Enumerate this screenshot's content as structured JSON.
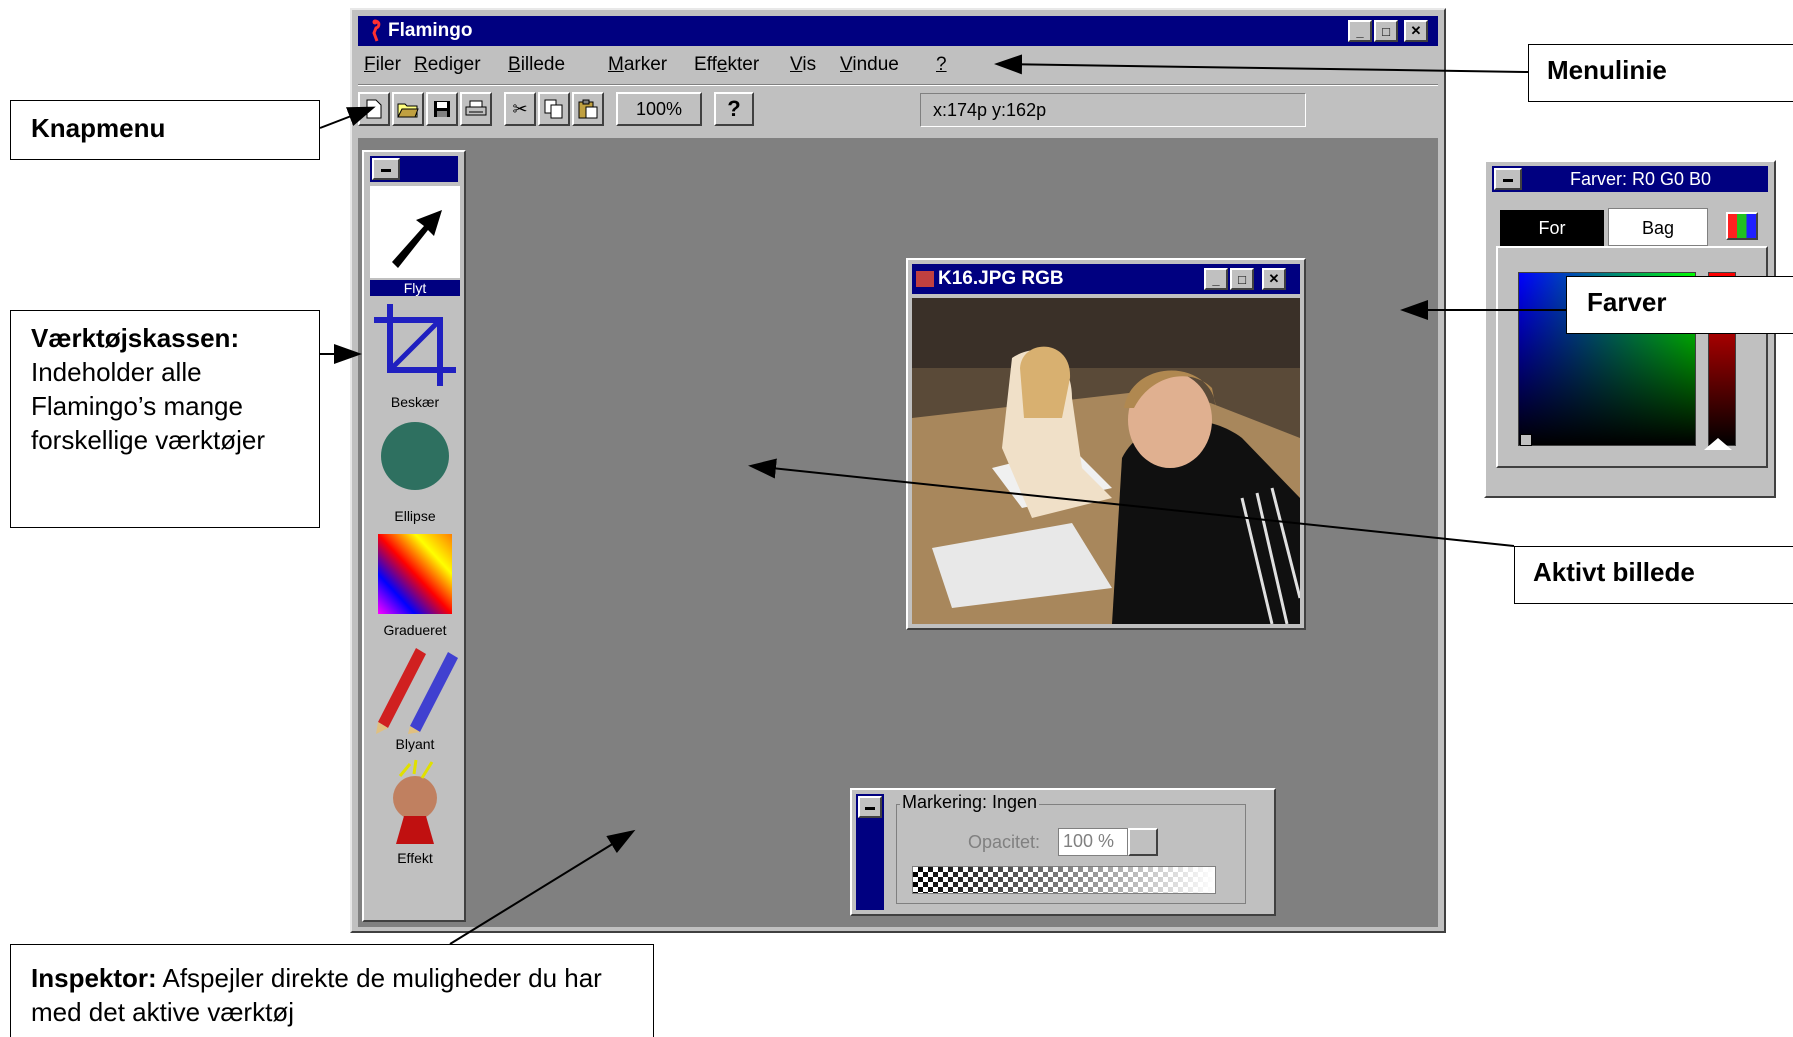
{
  "window": {
    "title": "Flamingo",
    "min_label": "_",
    "max_label": "□",
    "close_label": "✕"
  },
  "menu": {
    "items": [
      {
        "label": "Filer",
        "accel": "F",
        "rest": "iler"
      },
      {
        "label": "Rediger",
        "accel": "R",
        "rest": "ediger"
      },
      {
        "label": "Billede",
        "accel": "B",
        "rest": "illede"
      },
      {
        "label": "Marker",
        "accel": "M",
        "rest": "arker"
      },
      {
        "label": "Effekter",
        "pre": "Eff",
        "accel": "e",
        "rest": "kter"
      },
      {
        "label": "Vis",
        "accel": "V",
        "rest": "is"
      },
      {
        "label": "Vindue",
        "accel": "V",
        "rest": "indue"
      },
      {
        "label": "?",
        "accel": "?",
        "rest": ""
      }
    ]
  },
  "toolbar": {
    "zoom": "100%",
    "help": "?",
    "coords": "x:174p y:162p",
    "icons": [
      "new-document-icon",
      "open-folder-icon",
      "save-disk-icon",
      "print-icon",
      "cut-scissors-icon",
      "copy-icon",
      "paste-icon"
    ]
  },
  "toolbox": {
    "tools": [
      {
        "name": "Flyt",
        "icon": "move-arrow-icon"
      },
      {
        "name": "Beskær",
        "icon": "crop-icon"
      },
      {
        "name": "Ellipse",
        "icon": "ellipse-icon"
      },
      {
        "name": "Gradueret",
        "icon": "gradient-icon"
      },
      {
        "name": "Blyant",
        "icon": "pencil-icon"
      },
      {
        "name": "Effekt",
        "icon": "effect-icon"
      }
    ]
  },
  "image_window": {
    "title": "K16.JPG RGB"
  },
  "colors_window": {
    "title": "Farver: R0 G0 B0",
    "tab_fore": "For",
    "tab_back": "Bag",
    "colors": {
      "fore": "#000000",
      "back": "#ffffff",
      "titlebar": "#000080"
    }
  },
  "inspector": {
    "group_label": "Markering: Ingen",
    "opacity_label": "Opacitet:",
    "opacity_value": "100 %"
  },
  "annotations": {
    "menulinie": "Menulinie",
    "knapmenu": "Knapmenu",
    "farver": "Farver",
    "aktivt": "Aktivt billede",
    "vaerktoj_title": "Værktøjskassen:",
    "vaerktoj_text": "Indeholder alle Flamingo’s mange forskellige værktøjer",
    "inspektor_title": "Inspektor:",
    "inspektor_text": " Afspejler direkte de muligheder du har med det aktive værktøj"
  }
}
